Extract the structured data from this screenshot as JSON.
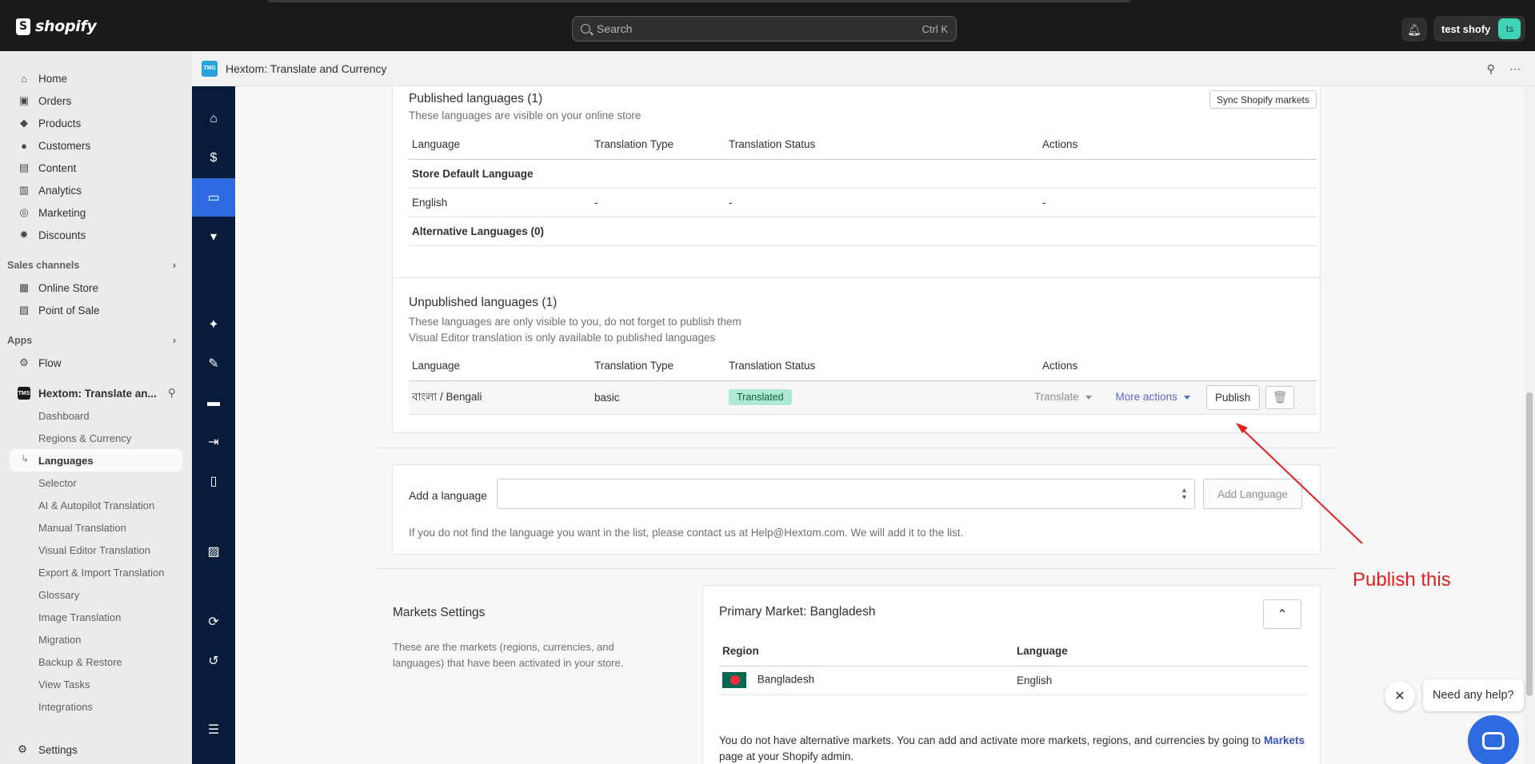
{
  "topbar": {
    "brand": "shopify",
    "search_placeholder": "Search",
    "search_shortcut": "Ctrl K",
    "user_name": "test shofy",
    "user_initials": "ts"
  },
  "sidebar": {
    "main": [
      {
        "label": "Home",
        "icon": "home-icon"
      },
      {
        "label": "Orders",
        "icon": "orders-icon"
      },
      {
        "label": "Products",
        "icon": "tag-icon"
      },
      {
        "label": "Customers",
        "icon": "person-icon"
      },
      {
        "label": "Content",
        "icon": "content-icon"
      },
      {
        "label": "Analytics",
        "icon": "bar-chart-icon"
      },
      {
        "label": "Marketing",
        "icon": "target-icon"
      },
      {
        "label": "Discounts",
        "icon": "discount-icon"
      }
    ],
    "sales_channels_label": "Sales channels",
    "sales_channels": [
      {
        "label": "Online Store",
        "icon": "store-icon"
      },
      {
        "label": "Point of Sale",
        "icon": "pos-icon"
      }
    ],
    "apps_label": "Apps",
    "apps": [
      {
        "label": "Flow",
        "icon": "flow-icon"
      }
    ],
    "app_name": "Hextom: Translate an...",
    "app_badge": "TMS",
    "app_subitems": [
      "Dashboard",
      "Regions & Currency",
      "Languages",
      "Selector",
      "AI & Autopilot Translation",
      "Manual Translation",
      "Visual Editor Translation",
      "Export & Import Translation",
      "Glossary",
      "Image Translation",
      "Migration",
      "Backup & Restore",
      "View Tasks",
      "Integrations"
    ],
    "settings_label": "Settings"
  },
  "app_header": {
    "title": "Hextom: Translate and Currency",
    "badge": "TMS"
  },
  "published": {
    "title": "Published languages (1)",
    "subtitle": "These languages are visible on your online store",
    "sync_button": "Sync Shopify markets",
    "columns": [
      "Language",
      "Translation Type",
      "Translation Status",
      "Actions"
    ],
    "default_group": "Store Default Language",
    "default_row": [
      "English",
      "-",
      "-",
      "-"
    ],
    "alt_group": "Alternative Languages (0)"
  },
  "unpublished": {
    "title": "Unpublished languages (1)",
    "subtitle1": "These languages are only visible to you, do not forget to publish them",
    "subtitle2": "Visual Editor translation is only available to published languages",
    "columns": [
      "Language",
      "Translation Type",
      "Translation Status",
      "Actions"
    ],
    "row": {
      "language": "বাংলা / Bengali",
      "type": "basic",
      "status": "Translated",
      "translate": "Translate",
      "more_actions": "More actions",
      "publish": "Publish"
    }
  },
  "add_language": {
    "label": "Add a language",
    "button": "Add Language",
    "help": "If you do not find the language you want in the list, please contact us at Help@Hextom.com. We will add it to the list."
  },
  "markets": {
    "title": "Markets Settings",
    "description": "These are the markets (regions, currencies, and languages) that have been activated in your store.",
    "primary_title": "Primary Market: Bangladesh",
    "columns": [
      "Region",
      "Language"
    ],
    "row": {
      "region": "Bangladesh",
      "language": "English"
    },
    "note_prefix": "You do not have alternative markets. You can add and activate more markets, regions, and currencies by going to",
    "note_link": "Markets",
    "note_suffix": "page at your Shopify admin."
  },
  "annotation": {
    "text": "Publish this",
    "color": "#e02020"
  },
  "chat": {
    "bubble": "Need any help?"
  },
  "colors": {
    "rail": "#071b3b",
    "accent": "#2e6ae0",
    "badge_green": "#aee9d1"
  }
}
